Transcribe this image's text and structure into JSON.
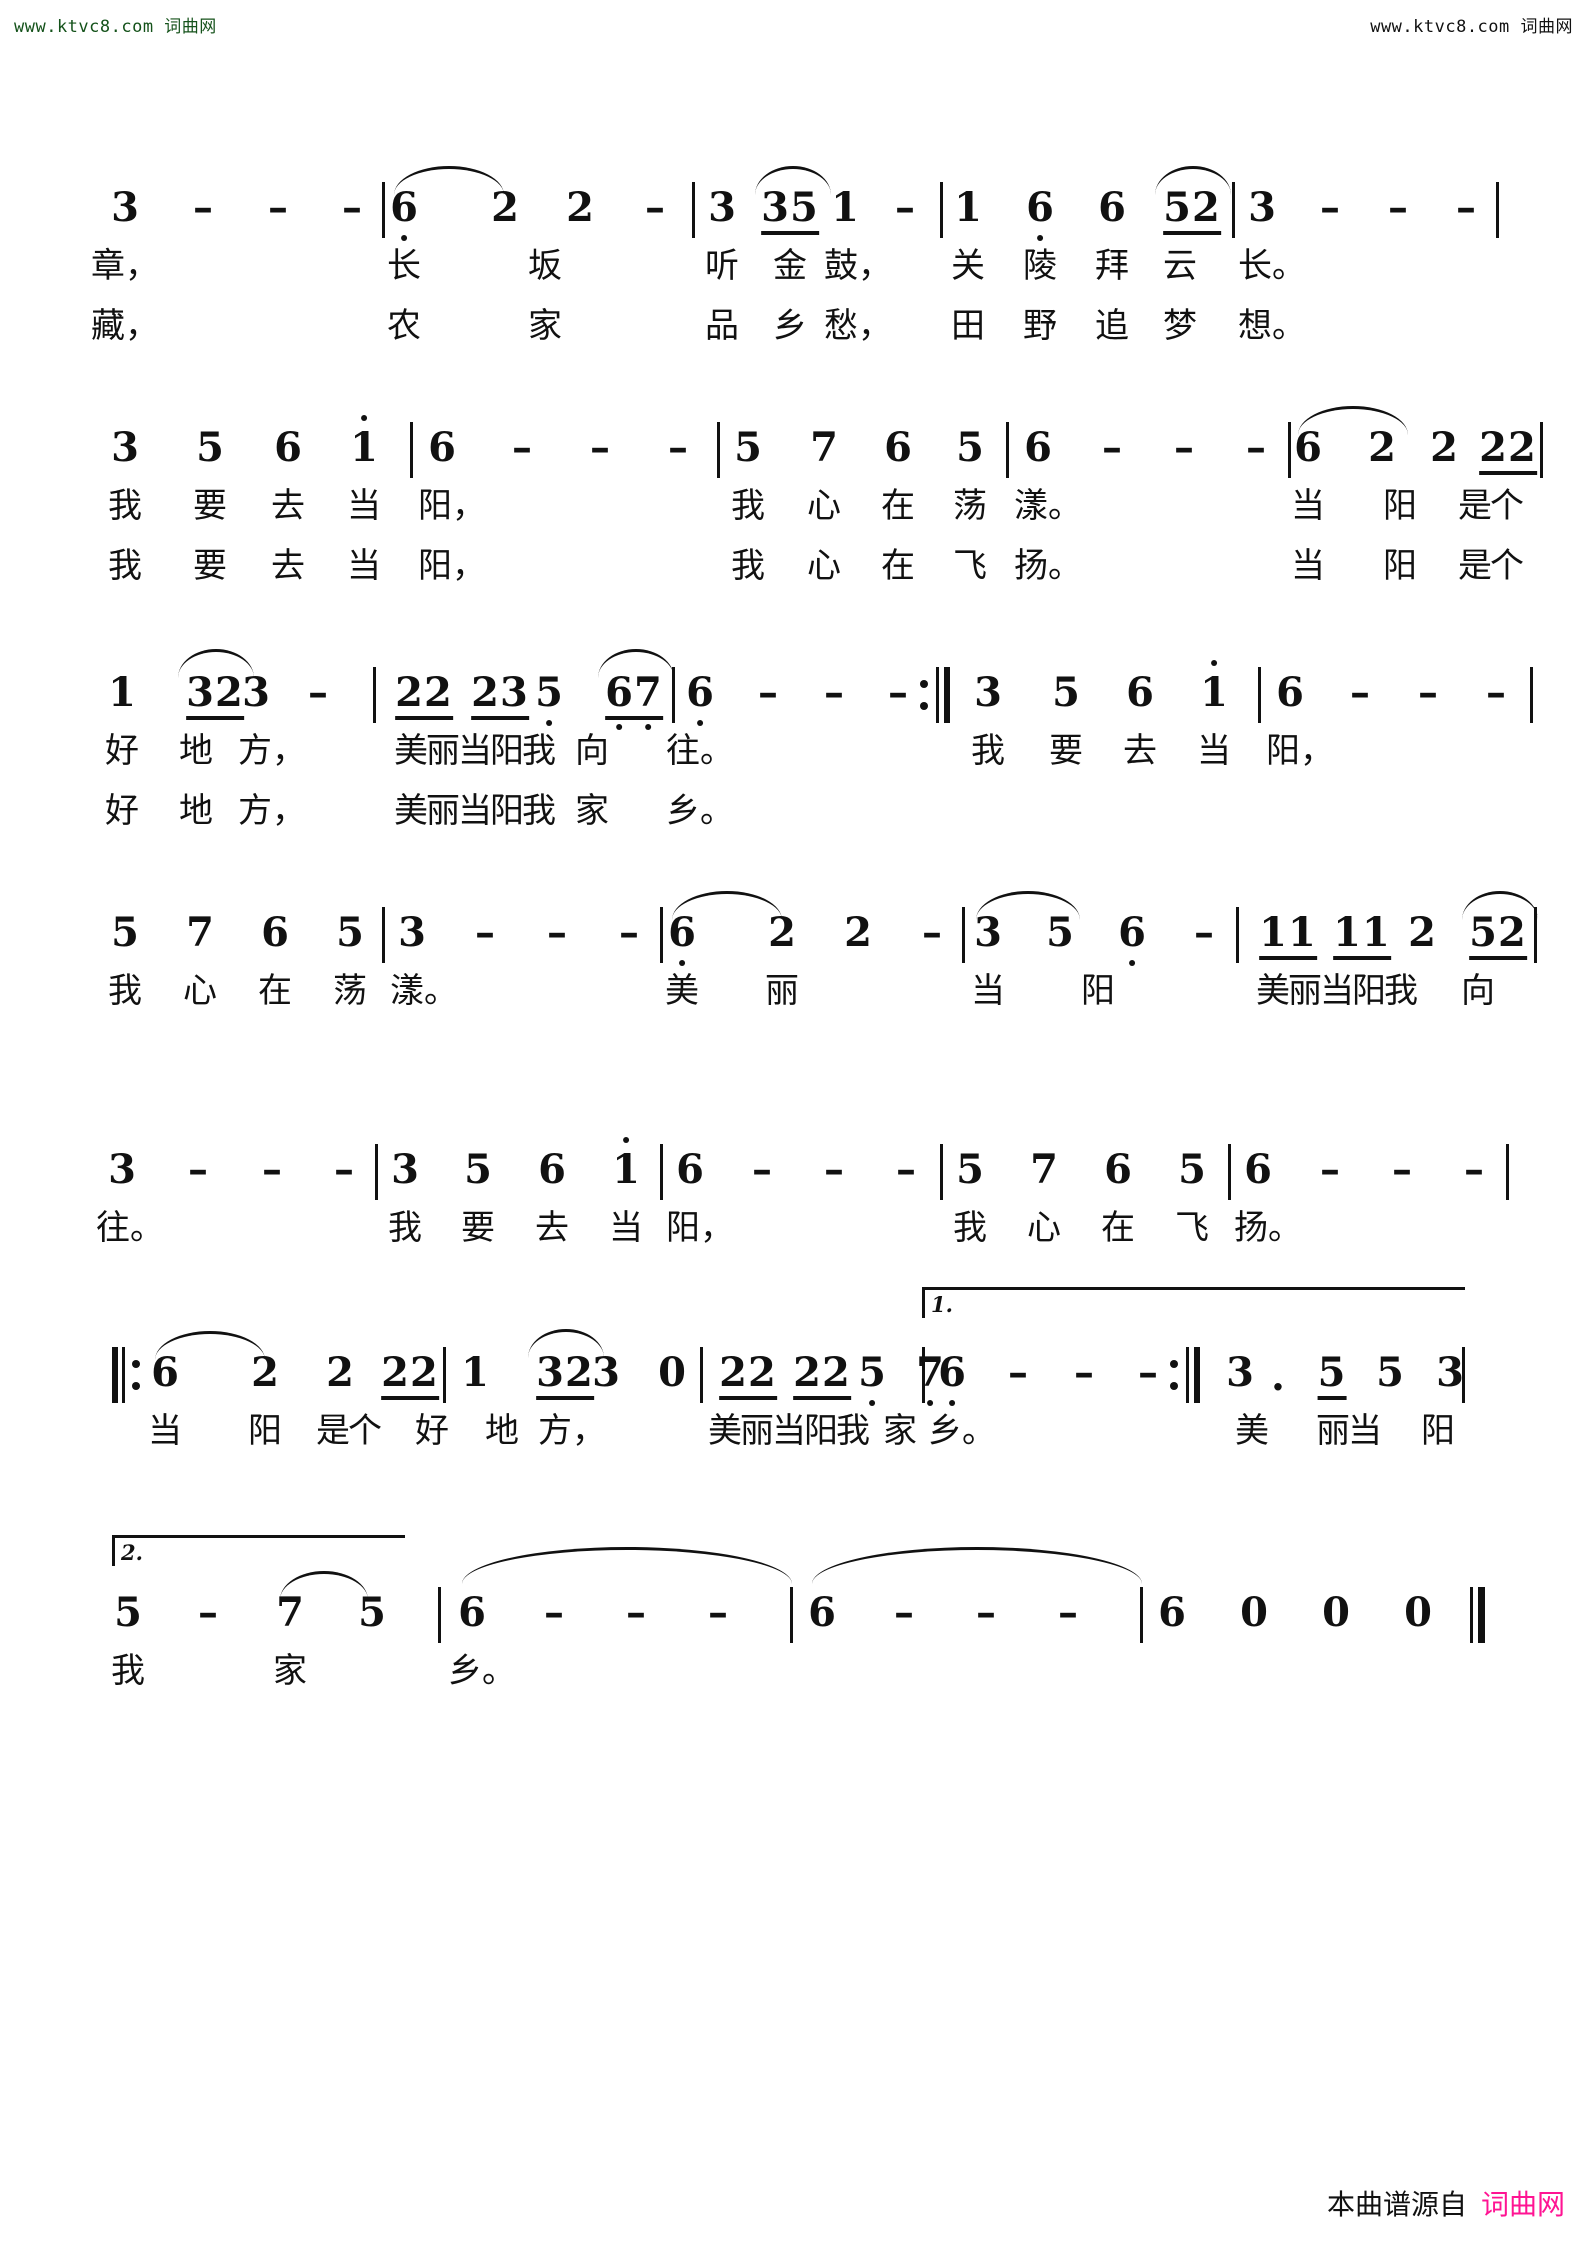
{
  "watermarks": {
    "top_left": "www.ktvc8.com 词曲网",
    "top_right": "www.ktvc8.com 词曲网",
    "top_left_color": "#14521a",
    "top_right_color": "#111111"
  },
  "footer": {
    "prefix": "本曲谱源自",
    "site": "词曲网",
    "site_color": "#ff1493"
  },
  "score": {
    "notation": "jianpu",
    "systems": [
      {
        "id": "system-1",
        "notes": "3 - - - | 6̣ 2 2 - | 3 35 1 - | 1 6̣ 6 52 | 3 - - - |",
        "lyric1": "章，　　　长　　坂　　听 金 鼓，　关 陵 拜 云　长。",
        "lyric2": "藏，　　　农　　家　　品 乡 愁，　田 野 追 梦　想。",
        "lyric1_tokens": [
          "章，",
          "长",
          "坂",
          "听",
          "金",
          "鼓，",
          "关",
          "陵",
          "拜",
          "云",
          "长。"
        ],
        "lyric2_tokens": [
          "藏，",
          "农",
          "家",
          "品",
          "乡",
          "愁，",
          "田",
          "野",
          "追",
          "梦",
          "想。"
        ]
      },
      {
        "id": "system-2",
        "notes": "3 5 6 1̇ | 6 - - - | 5 7 6 5 | 6 - - - | 6 2 2 22 |",
        "lyric1_tokens": [
          "我",
          "要",
          "去",
          "当",
          "阳，",
          "我",
          "心",
          "在",
          "荡",
          "漾。",
          "当",
          "阳",
          "是个"
        ],
        "lyric2_tokens": [
          "我",
          "要",
          "去",
          "当",
          "阳，",
          "我",
          "心",
          "在",
          "飞",
          "扬。",
          "当",
          "阳",
          "是个"
        ]
      },
      {
        "id": "system-3",
        "notes": "1 32 3 - | 22 23 5̣ 6̣7̣ | 6̣ - - - :|| 3 5 6 1̇ | 6 - - - |",
        "lyric1_tokens": [
          "好",
          "地",
          "方，",
          "美丽当阳我",
          "向",
          "往。",
          "我",
          "要",
          "去",
          "当",
          "阳，"
        ],
        "lyric2_tokens": [
          "好",
          "地",
          "方，",
          "美丽当阳我",
          "家",
          "乡。"
        ]
      },
      {
        "id": "system-4",
        "notes": "5 7 6 5 | 3 - - - | 6̣ 2 2 - | 3 5 6̣ - | 11 11 2 52 |",
        "lyric1_tokens": [
          "我",
          "心",
          "在",
          "荡",
          "漾。",
          "美",
          "丽",
          "当",
          "阳",
          "美丽当阳我",
          "向"
        ]
      },
      {
        "id": "system-5",
        "notes": "3 - - - | 3 5 6 1̇ | 6 - - - | 5 7 6 5 | 6 - - - |",
        "lyric1_tokens": [
          "往。",
          "我",
          "要",
          "去",
          "当",
          "阳，",
          "我",
          "心",
          "在",
          "飞",
          "扬。"
        ]
      },
      {
        "id": "system-6",
        "notes": "||: 6 2 2 22 | 1 32 3 0 | 22 22 5̣ 7̣ | [1.] 6̣ - - - :|| 3. 5 5 3 |",
        "lyric1_tokens": [
          "当",
          "阳",
          "是个",
          "好",
          "地",
          "方，",
          "美丽当阳我",
          "家",
          "乡。",
          "美",
          "丽当",
          "阳"
        ]
      },
      {
        "id": "system-7",
        "notes": "[2.] 5 - 7 5 | 6 - - - | 6 - - - | 6 0 0 0 ||",
        "lyric1_tokens": [
          "我",
          "家",
          "乡。"
        ]
      }
    ],
    "volta1_label": "1.",
    "volta2_label": "2."
  }
}
